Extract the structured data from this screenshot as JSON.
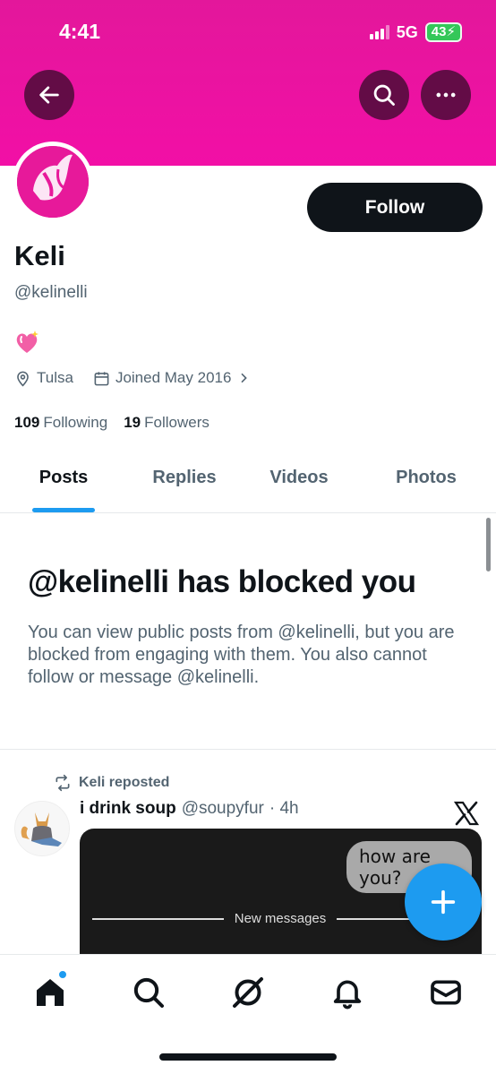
{
  "status_bar": {
    "time": "4:41",
    "network": "5G",
    "battery": "43"
  },
  "colors": {
    "banner": "#e3179b",
    "accent": "#1d9bf0",
    "follow_button": "#0f1419"
  },
  "profile": {
    "display_name": "Keli",
    "handle": "@kelinelli",
    "bio_emoji": "sparkling-heart",
    "location": "Tulsa",
    "joined": "Joined May 2016",
    "following_count": "109",
    "following_label": "Following",
    "followers_count": "19",
    "followers_label": "Followers",
    "follow_label": "Follow"
  },
  "tabs": [
    {
      "label": "Posts",
      "active": true
    },
    {
      "label": "Replies",
      "active": false
    },
    {
      "label": "Videos",
      "active": false
    },
    {
      "label": "Photos",
      "active": false
    }
  ],
  "blocked": {
    "title": "@kelinelli has blocked you",
    "message": "You can view public posts from @kelinelli, but you are blocked from engaging with them. You also cannot follow or message @kelinelli."
  },
  "post": {
    "repost_label": "Keli reposted",
    "author_name": "i drink soup",
    "author_handle": "@soupyfur",
    "time": "· 4h",
    "media": {
      "bubble_text": "how are you?",
      "divider_text": "New messages"
    }
  },
  "icons": {
    "back": "arrow-left-icon",
    "search": "search-icon",
    "more": "more-icon",
    "home": "home-icon",
    "explore": "search-icon",
    "grok": "grok-icon",
    "notifications": "bell-icon",
    "messages": "envelope-icon",
    "compose": "plus-icon"
  }
}
